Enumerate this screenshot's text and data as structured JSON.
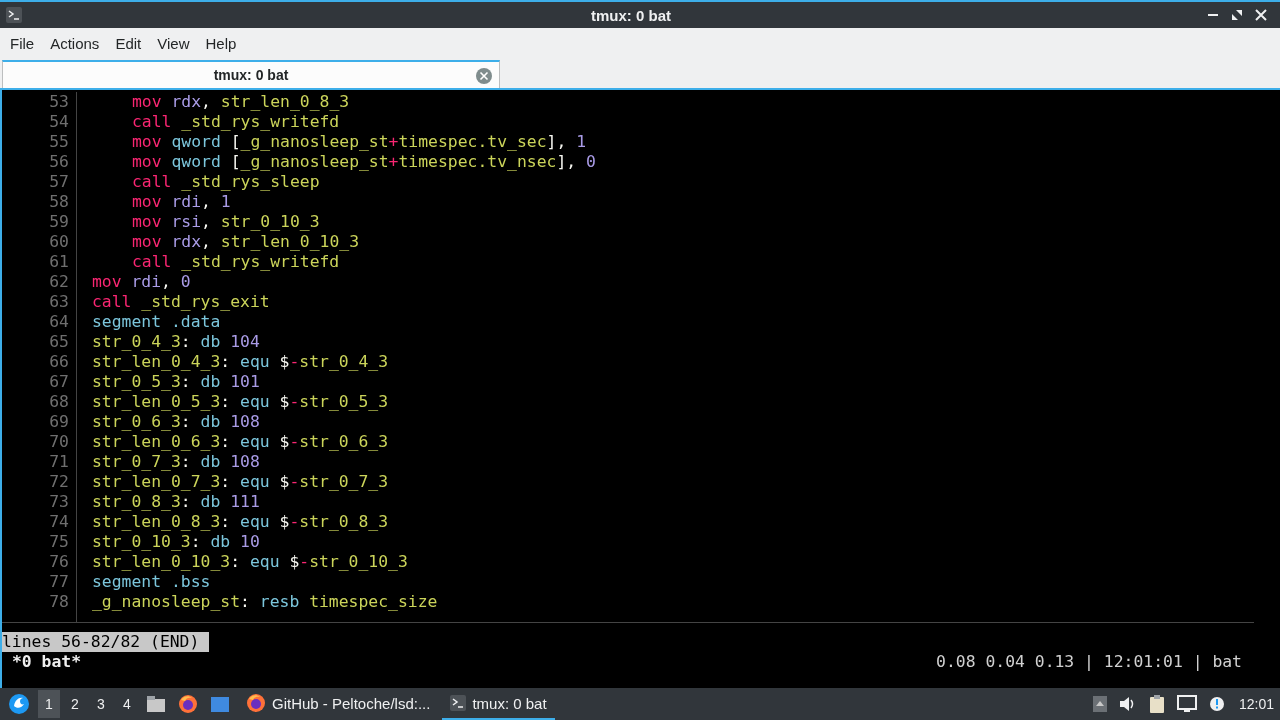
{
  "window": {
    "title": "tmux: 0 bat"
  },
  "menu": [
    "File",
    "Actions",
    "Edit",
    "View",
    "Help"
  ],
  "tabs": [
    {
      "label": "tmux: 0 bat",
      "selected": true
    }
  ],
  "code_lines": [
    {
      "number": "53",
      "indented": true,
      "tokens": [
        {
          "kind": "kw",
          "t": "mov "
        },
        {
          "kind": "reg",
          "t": "rdx"
        },
        {
          "kind": "p",
          "t": ", "
        },
        {
          "kind": "id",
          "t": "str_len_0_8_3"
        }
      ]
    },
    {
      "number": "54",
      "indented": true,
      "tokens": [
        {
          "kind": "kw",
          "t": "call "
        },
        {
          "kind": "id",
          "t": "_std_rys_writefd"
        }
      ]
    },
    {
      "number": "55",
      "indented": true,
      "tokens": [
        {
          "kind": "kw",
          "t": "mov "
        },
        {
          "kind": "dir",
          "t": "qword "
        },
        {
          "kind": "p",
          "t": "["
        },
        {
          "kind": "id",
          "t": "_g_nanosleep_st"
        },
        {
          "kind": "op",
          "t": "+"
        },
        {
          "kind": "id",
          "t": "timespec.tv_sec"
        },
        {
          "kind": "p",
          "t": "], "
        },
        {
          "kind": "num",
          "t": "1"
        }
      ]
    },
    {
      "number": "56",
      "indented": true,
      "tokens": [
        {
          "kind": "kw",
          "t": "mov "
        },
        {
          "kind": "dir",
          "t": "qword "
        },
        {
          "kind": "p",
          "t": "["
        },
        {
          "kind": "id",
          "t": "_g_nanosleep_st"
        },
        {
          "kind": "op",
          "t": "+"
        },
        {
          "kind": "id",
          "t": "timespec.tv_nsec"
        },
        {
          "kind": "p",
          "t": "], "
        },
        {
          "kind": "num",
          "t": "0"
        }
      ]
    },
    {
      "number": "57",
      "indented": true,
      "tokens": [
        {
          "kind": "kw",
          "t": "call "
        },
        {
          "kind": "id",
          "t": "_std_rys_sleep"
        }
      ]
    },
    {
      "number": "58",
      "indented": true,
      "tokens": [
        {
          "kind": "kw",
          "t": "mov "
        },
        {
          "kind": "reg",
          "t": "rdi"
        },
        {
          "kind": "p",
          "t": ", "
        },
        {
          "kind": "num",
          "t": "1"
        }
      ]
    },
    {
      "number": "59",
      "indented": true,
      "tokens": [
        {
          "kind": "kw",
          "t": "mov "
        },
        {
          "kind": "reg",
          "t": "rsi"
        },
        {
          "kind": "p",
          "t": ", "
        },
        {
          "kind": "id",
          "t": "str_0_10_3"
        }
      ]
    },
    {
      "number": "60",
      "indented": true,
      "tokens": [
        {
          "kind": "kw",
          "t": "mov "
        },
        {
          "kind": "reg",
          "t": "rdx"
        },
        {
          "kind": "p",
          "t": ", "
        },
        {
          "kind": "id",
          "t": "str_len_0_10_3"
        }
      ]
    },
    {
      "number": "61",
      "indented": true,
      "tokens": [
        {
          "kind": "kw",
          "t": "call "
        },
        {
          "kind": "id",
          "t": "_std_rys_writefd"
        }
      ]
    },
    {
      "number": "62",
      "indented": false,
      "tokens": [
        {
          "kind": "kw",
          "t": "mov "
        },
        {
          "kind": "reg",
          "t": "rdi"
        },
        {
          "kind": "p",
          "t": ", "
        },
        {
          "kind": "num",
          "t": "0"
        }
      ]
    },
    {
      "number": "63",
      "indented": false,
      "tokens": [
        {
          "kind": "kw",
          "t": "call "
        },
        {
          "kind": "id",
          "t": "_std_rys_exit"
        }
      ]
    },
    {
      "number": "64",
      "indented": false,
      "tokens": [
        {
          "kind": "dir",
          "t": "segment .data"
        }
      ]
    },
    {
      "number": "65",
      "indented": false,
      "tokens": [
        {
          "kind": "id",
          "t": "str_0_4_3"
        },
        {
          "kind": "p",
          "t": ": "
        },
        {
          "kind": "dir",
          "t": "db "
        },
        {
          "kind": "num",
          "t": "104"
        }
      ]
    },
    {
      "number": "66",
      "indented": false,
      "tokens": [
        {
          "kind": "id",
          "t": "str_len_0_4_3"
        },
        {
          "kind": "p",
          "t": ": "
        },
        {
          "kind": "dir",
          "t": "equ "
        },
        {
          "kind": "p",
          "t": "$"
        },
        {
          "kind": "op",
          "t": "-"
        },
        {
          "kind": "id",
          "t": "str_0_4_3"
        }
      ]
    },
    {
      "number": "67",
      "indented": false,
      "tokens": [
        {
          "kind": "id",
          "t": "str_0_5_3"
        },
        {
          "kind": "p",
          "t": ": "
        },
        {
          "kind": "dir",
          "t": "db "
        },
        {
          "kind": "num",
          "t": "101"
        }
      ]
    },
    {
      "number": "68",
      "indented": false,
      "tokens": [
        {
          "kind": "id",
          "t": "str_len_0_5_3"
        },
        {
          "kind": "p",
          "t": ": "
        },
        {
          "kind": "dir",
          "t": "equ "
        },
        {
          "kind": "p",
          "t": "$"
        },
        {
          "kind": "op",
          "t": "-"
        },
        {
          "kind": "id",
          "t": "str_0_5_3"
        }
      ]
    },
    {
      "number": "69",
      "indented": false,
      "tokens": [
        {
          "kind": "id",
          "t": "str_0_6_3"
        },
        {
          "kind": "p",
          "t": ": "
        },
        {
          "kind": "dir",
          "t": "db "
        },
        {
          "kind": "num",
          "t": "108"
        }
      ]
    },
    {
      "number": "70",
      "indented": false,
      "tokens": [
        {
          "kind": "id",
          "t": "str_len_0_6_3"
        },
        {
          "kind": "p",
          "t": ": "
        },
        {
          "kind": "dir",
          "t": "equ "
        },
        {
          "kind": "p",
          "t": "$"
        },
        {
          "kind": "op",
          "t": "-"
        },
        {
          "kind": "id",
          "t": "str_0_6_3"
        }
      ]
    },
    {
      "number": "71",
      "indented": false,
      "tokens": [
        {
          "kind": "id",
          "t": "str_0_7_3"
        },
        {
          "kind": "p",
          "t": ": "
        },
        {
          "kind": "dir",
          "t": "db "
        },
        {
          "kind": "num",
          "t": "108"
        }
      ]
    },
    {
      "number": "72",
      "indented": false,
      "tokens": [
        {
          "kind": "id",
          "t": "str_len_0_7_3"
        },
        {
          "kind": "p",
          "t": ": "
        },
        {
          "kind": "dir",
          "t": "equ "
        },
        {
          "kind": "p",
          "t": "$"
        },
        {
          "kind": "op",
          "t": "-"
        },
        {
          "kind": "id",
          "t": "str_0_7_3"
        }
      ]
    },
    {
      "number": "73",
      "indented": false,
      "tokens": [
        {
          "kind": "id",
          "t": "str_0_8_3"
        },
        {
          "kind": "p",
          "t": ": "
        },
        {
          "kind": "dir",
          "t": "db "
        },
        {
          "kind": "num",
          "t": "111"
        }
      ]
    },
    {
      "number": "74",
      "indented": false,
      "tokens": [
        {
          "kind": "id",
          "t": "str_len_0_8_3"
        },
        {
          "kind": "p",
          "t": ": "
        },
        {
          "kind": "dir",
          "t": "equ "
        },
        {
          "kind": "p",
          "t": "$"
        },
        {
          "kind": "op",
          "t": "-"
        },
        {
          "kind": "id",
          "t": "str_0_8_3"
        }
      ]
    },
    {
      "number": "75",
      "indented": false,
      "tokens": [
        {
          "kind": "id",
          "t": "str_0_10_3"
        },
        {
          "kind": "p",
          "t": ": "
        },
        {
          "kind": "dir",
          "t": "db "
        },
        {
          "kind": "num",
          "t": "10"
        }
      ]
    },
    {
      "number": "76",
      "indented": false,
      "tokens": [
        {
          "kind": "id",
          "t": "str_len_0_10_3"
        },
        {
          "kind": "p",
          "t": ": "
        },
        {
          "kind": "dir",
          "t": "equ "
        },
        {
          "kind": "p",
          "t": "$"
        },
        {
          "kind": "op",
          "t": "-"
        },
        {
          "kind": "id",
          "t": "str_0_10_3"
        }
      ]
    },
    {
      "number": "77",
      "indented": false,
      "tokens": [
        {
          "kind": "dir",
          "t": "segment .bss"
        }
      ]
    },
    {
      "number": "78",
      "indented": false,
      "tokens": [
        {
          "kind": "id",
          "t": "_g_nanosleep_st"
        },
        {
          "kind": "p",
          "t": ": "
        },
        {
          "kind": "dir",
          "t": "resb "
        },
        {
          "kind": "id",
          "t": "timespec_size"
        }
      ]
    }
  ],
  "pager_status": "lines 56-82/82 (END)",
  "tmux_status": {
    "window": "*0 bat*",
    "right": "0.08 0.04 0.13 | 12:01:01 | bat"
  },
  "taskbar": {
    "workspaces": [
      {
        "label": "1",
        "selected": true
      },
      {
        "label": "2",
        "selected": false
      },
      {
        "label": "3",
        "selected": false
      },
      {
        "label": "4",
        "selected": false
      }
    ],
    "tasks": [
      {
        "label": "GitHub - Peltoche/lsd:...",
        "kind": "browser",
        "selected": false
      },
      {
        "label": "tmux: 0 bat",
        "kind": "terminal",
        "selected": true
      }
    ],
    "clock": "12:01"
  }
}
